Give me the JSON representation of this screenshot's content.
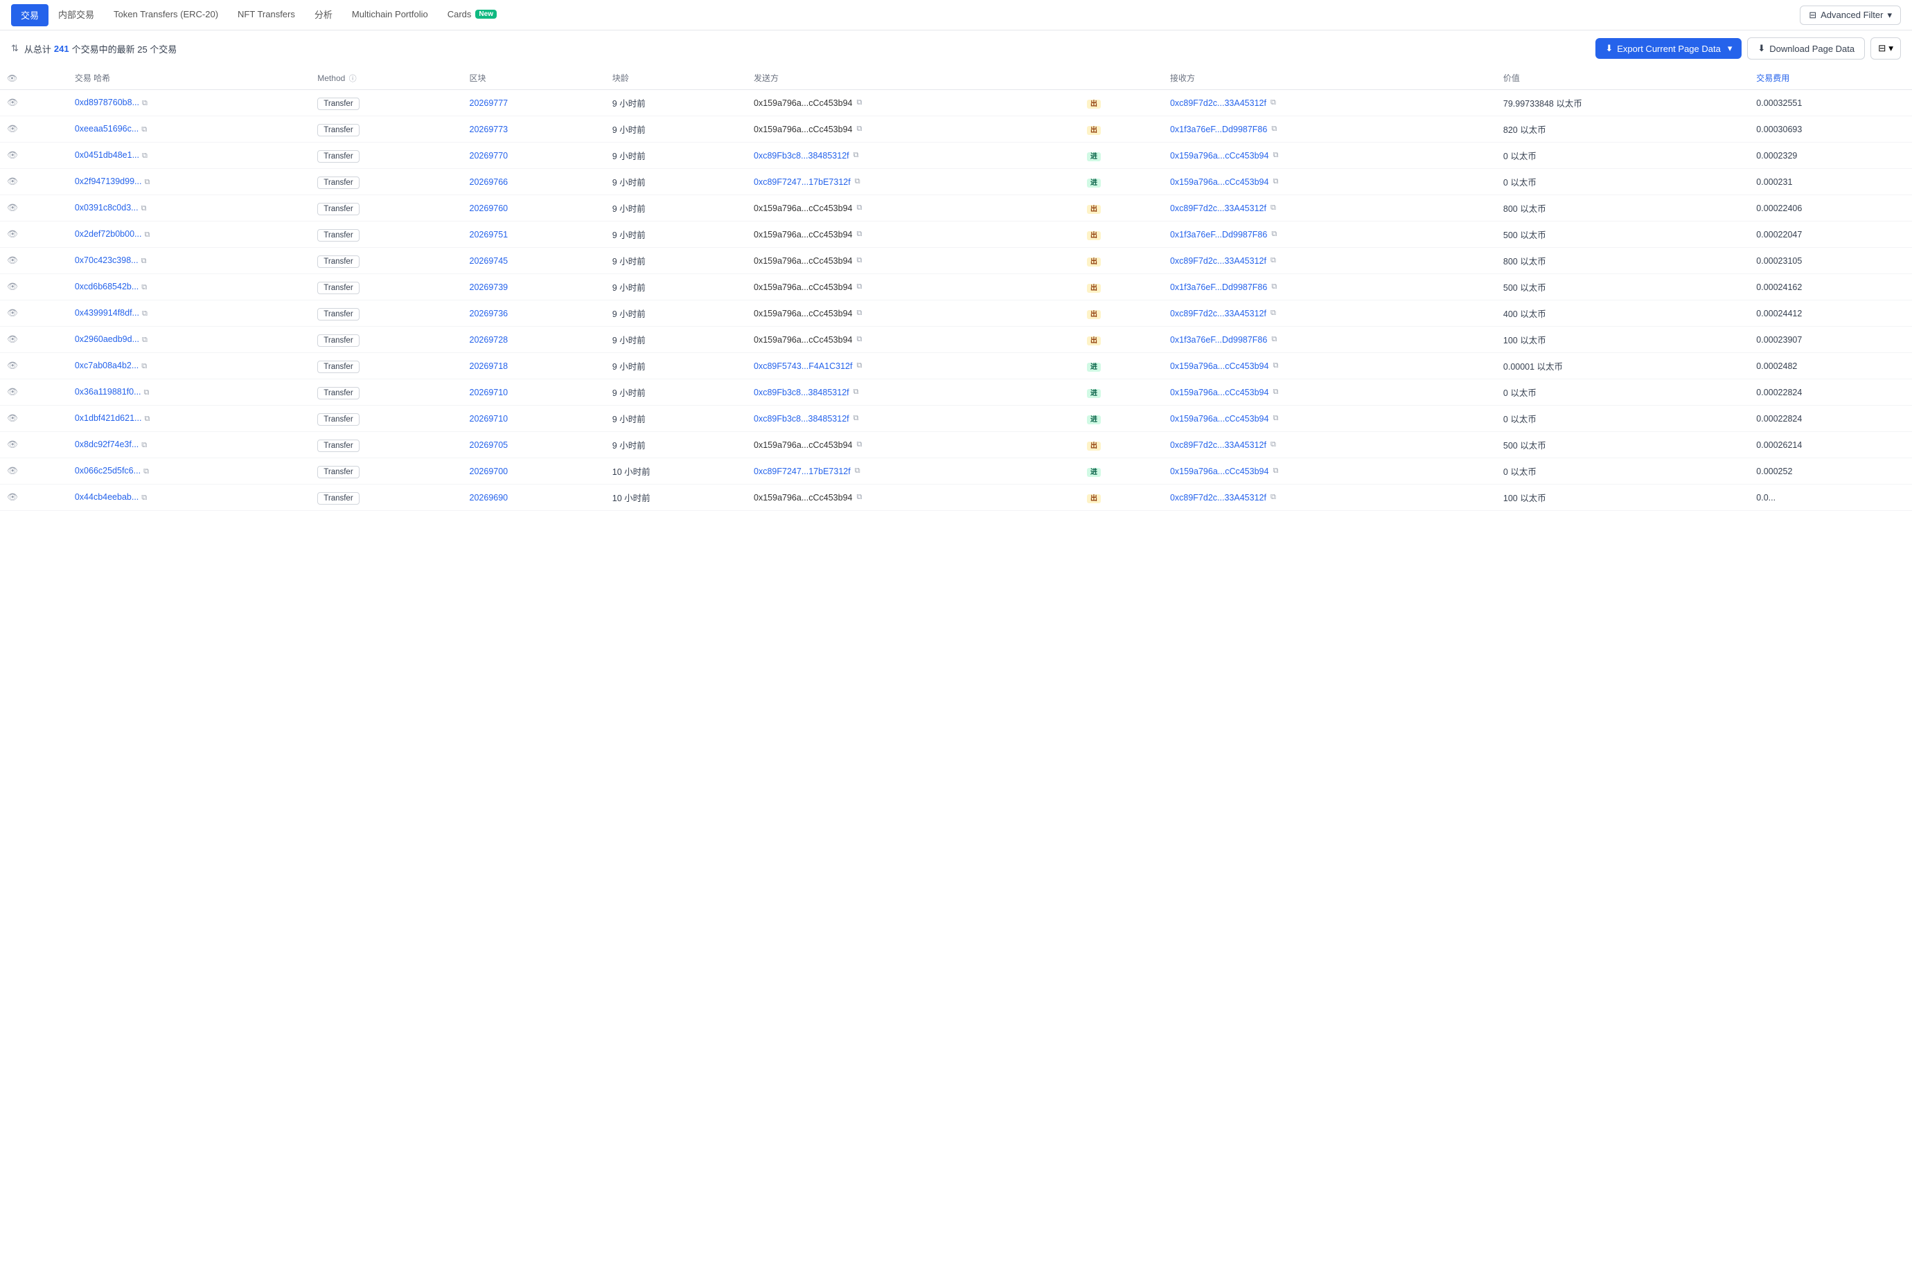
{
  "nav": {
    "tabs": [
      {
        "label": "交易",
        "active": true,
        "id": "tx"
      },
      {
        "label": "内部交易",
        "active": false,
        "id": "internal"
      },
      {
        "label": "Token Transfers (ERC-20)",
        "active": false,
        "id": "erc20"
      },
      {
        "label": "NFT Transfers",
        "active": false,
        "id": "nft"
      },
      {
        "label": "分析",
        "active": false,
        "id": "analytics"
      },
      {
        "label": "Multichain Portfolio",
        "active": false,
        "id": "multichain"
      },
      {
        "label": "Cards",
        "active": false,
        "id": "cards",
        "badge": "New"
      }
    ],
    "advanced_filter": "Advanced Filter"
  },
  "subtitle": {
    "sort_label": "从总计",
    "count": "241",
    "text": "个交易中的最新 25 个交易"
  },
  "actions": {
    "export_label": "Export Current Page Data",
    "download_label": "Download Page Data"
  },
  "table": {
    "headers": [
      "",
      "交易 哈希",
      "Method",
      "区块",
      "块龄",
      "发送方",
      "",
      "接收方",
      "价值",
      "交易费用"
    ],
    "rows": [
      {
        "hash": "0xd8978760b8...",
        "method": "Transfer",
        "block": "20269777",
        "age": "9 小时前",
        "sender": "0x159a796a...cCc453b94",
        "sender_tag": "out",
        "receiver": "0xc89F7d2c...33A45312f",
        "receiver_tag": "",
        "value": "79.99733848 以太币",
        "fee": "0.00032551"
      },
      {
        "hash": "0xeeaa51696c...",
        "method": "Transfer",
        "block": "20269773",
        "age": "9 小时前",
        "sender": "0x159a796a...cCc453b94",
        "sender_tag": "out",
        "receiver": "0x1f3a76eF...Dd9987F86",
        "receiver_tag": "",
        "value": "820 以太币",
        "fee": "0.00030693"
      },
      {
        "hash": "0x0451db48e1...",
        "method": "Transfer",
        "block": "20269770",
        "age": "9 小时前",
        "sender": "0xc89Fb3c8...38485312f",
        "sender_tag": "in",
        "receiver": "0x159a796a...cCc453b94",
        "receiver_tag": "",
        "value": "0 以太币",
        "fee": "0.0002329"
      },
      {
        "hash": "0x2f947139d99...",
        "method": "Transfer",
        "block": "20269766",
        "age": "9 小时前",
        "sender": "0xc89F7247...17bE7312f",
        "sender_tag": "in",
        "receiver": "0x159a796a...cCc453b94",
        "receiver_tag": "",
        "value": "0 以太币",
        "fee": "0.000231"
      },
      {
        "hash": "0x0391c8c0d3...",
        "method": "Transfer",
        "block": "20269760",
        "age": "9 小时前",
        "sender": "0x159a796a...cCc453b94",
        "sender_tag": "out",
        "receiver": "0xc89F7d2c...33A45312f",
        "receiver_tag": "",
        "value": "800 以太币",
        "fee": "0.00022406"
      },
      {
        "hash": "0x2def72b0b00...",
        "method": "Transfer",
        "block": "20269751",
        "age": "9 小时前",
        "sender": "0x159a796a...cCc453b94",
        "sender_tag": "out",
        "receiver": "0x1f3a76eF...Dd9987F86",
        "receiver_tag": "",
        "value": "500 以太币",
        "fee": "0.00022047"
      },
      {
        "hash": "0x70c423c398...",
        "method": "Transfer",
        "block": "20269745",
        "age": "9 小时前",
        "sender": "0x159a796a...cCc453b94",
        "sender_tag": "out",
        "receiver": "0xc89F7d2c...33A45312f",
        "receiver_tag": "",
        "value": "800 以太币",
        "fee": "0.00023105"
      },
      {
        "hash": "0xcd6b68542b...",
        "method": "Transfer",
        "block": "20269739",
        "age": "9 小时前",
        "sender": "0x159a796a...cCc453b94",
        "sender_tag": "out",
        "receiver": "0x1f3a76eF...Dd9987F86",
        "receiver_tag": "",
        "value": "500 以太币",
        "fee": "0.00024162"
      },
      {
        "hash": "0x4399914f8df...",
        "method": "Transfer",
        "block": "20269736",
        "age": "9 小时前",
        "sender": "0x159a796a...cCc453b94",
        "sender_tag": "out",
        "receiver": "0xc89F7d2c...33A45312f",
        "receiver_tag": "",
        "value": "400 以太币",
        "fee": "0.00024412"
      },
      {
        "hash": "0x2960aedb9d...",
        "method": "Transfer",
        "block": "20269728",
        "age": "9 小时前",
        "sender": "0x159a796a...cCc453b94",
        "sender_tag": "out",
        "receiver": "0x1f3a76eF...Dd9987F86",
        "receiver_tag": "",
        "value": "100 以太币",
        "fee": "0.00023907"
      },
      {
        "hash": "0xc7ab08a4b2...",
        "method": "Transfer",
        "block": "20269718",
        "age": "9 小时前",
        "sender": "0xc89F5743...F4A1C312f",
        "sender_tag": "in",
        "receiver": "0x159a796a...cCc453b94",
        "receiver_tag": "",
        "value": "0.00001 以太币",
        "fee": "0.0002482"
      },
      {
        "hash": "0x36a119881f0...",
        "method": "Transfer",
        "block": "20269710",
        "age": "9 小时前",
        "sender": "0xc89Fb3c8...38485312f",
        "sender_tag": "in",
        "receiver": "0x159a796a...cCc453b94",
        "receiver_tag": "",
        "value": "0 以太币",
        "fee": "0.00022824"
      },
      {
        "hash": "0x1dbf421d621...",
        "method": "Transfer",
        "block": "20269710",
        "age": "9 小时前",
        "sender": "0xc89Fb3c8...38485312f",
        "sender_tag": "in",
        "receiver": "0x159a796a...cCc453b94",
        "receiver_tag": "",
        "value": "0 以太币",
        "fee": "0.00022824"
      },
      {
        "hash": "0x8dc92f74e3f...",
        "method": "Transfer",
        "block": "20269705",
        "age": "9 小时前",
        "sender": "0x159a796a...cCc453b94",
        "sender_tag": "out",
        "receiver": "0xc89F7d2c...33A45312f",
        "receiver_tag": "",
        "value": "500 以太币",
        "fee": "0.00026214"
      },
      {
        "hash": "0x066c25d5fc6...",
        "method": "Transfer",
        "block": "20269700",
        "age": "10 小时前",
        "sender": "0xc89F7247...17bE7312f",
        "sender_tag": "in",
        "receiver": "0x159a796a...cCc453b94",
        "receiver_tag": "",
        "value": "0 以太币",
        "fee": "0.000252"
      },
      {
        "hash": "0x44cb4eebab...",
        "method": "Transfer",
        "block": "20269690",
        "age": "10 小时前",
        "sender": "0x159a796a...cCc453b94",
        "sender_tag": "out",
        "receiver": "0xc89F7d2c...33A45312f",
        "receiver_tag": "",
        "value": "100 以太币",
        "fee": "0.0..."
      }
    ]
  },
  "icons": {
    "eye": "👁",
    "copy": "⧉",
    "download": "⬇",
    "export": "⬇",
    "filter": "⊟",
    "sort": "⇅",
    "info": "ⓘ",
    "dropdown": "▾"
  }
}
